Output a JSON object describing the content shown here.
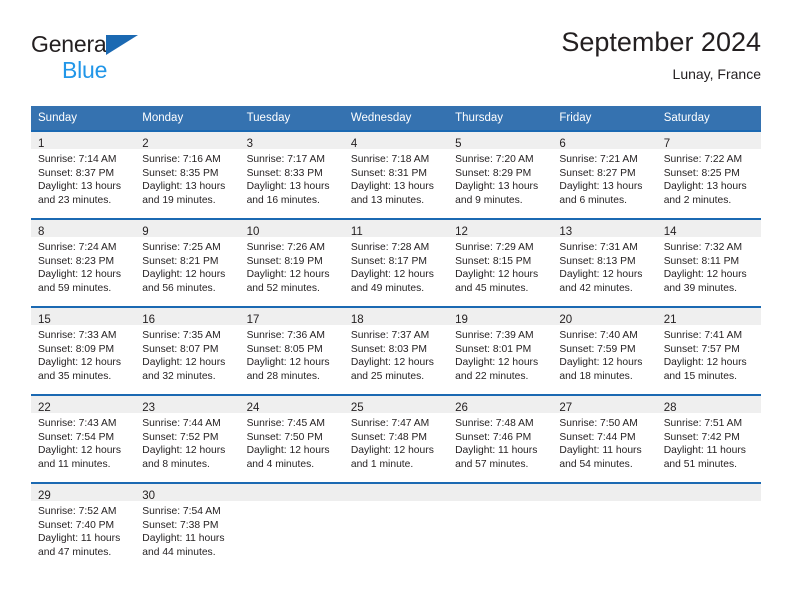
{
  "brand": {
    "name_dark": "General",
    "name_light": "Blue",
    "logo_icon": "triangle-icon"
  },
  "header": {
    "month_title": "September 2024",
    "location": "Lunay, France"
  },
  "theme": {
    "header_blue": "#3572b0",
    "rule_blue": "#1b69b2",
    "daynum_band": "#efefef",
    "brand_blue": "#2196e8",
    "text": "#231f20"
  },
  "weekday_headers": [
    "Sunday",
    "Monday",
    "Tuesday",
    "Wednesday",
    "Thursday",
    "Friday",
    "Saturday"
  ],
  "labels": {
    "sunrise": "Sunrise:",
    "sunset": "Sunset:",
    "daylight": "Daylight:"
  },
  "weeks": [
    [
      {
        "day": "1",
        "sunrise": "Sunrise: 7:14 AM",
        "sunset": "Sunset: 8:37 PM",
        "daylight_1": "Daylight: 13 hours",
        "daylight_2": "and 23 minutes."
      },
      {
        "day": "2",
        "sunrise": "Sunrise: 7:16 AM",
        "sunset": "Sunset: 8:35 PM",
        "daylight_1": "Daylight: 13 hours",
        "daylight_2": "and 19 minutes."
      },
      {
        "day": "3",
        "sunrise": "Sunrise: 7:17 AM",
        "sunset": "Sunset: 8:33 PM",
        "daylight_1": "Daylight: 13 hours",
        "daylight_2": "and 16 minutes."
      },
      {
        "day": "4",
        "sunrise": "Sunrise: 7:18 AM",
        "sunset": "Sunset: 8:31 PM",
        "daylight_1": "Daylight: 13 hours",
        "daylight_2": "and 13 minutes."
      },
      {
        "day": "5",
        "sunrise": "Sunrise: 7:20 AM",
        "sunset": "Sunset: 8:29 PM",
        "daylight_1": "Daylight: 13 hours",
        "daylight_2": "and 9 minutes."
      },
      {
        "day": "6",
        "sunrise": "Sunrise: 7:21 AM",
        "sunset": "Sunset: 8:27 PM",
        "daylight_1": "Daylight: 13 hours",
        "daylight_2": "and 6 minutes."
      },
      {
        "day": "7",
        "sunrise": "Sunrise: 7:22 AM",
        "sunset": "Sunset: 8:25 PM",
        "daylight_1": "Daylight: 13 hours",
        "daylight_2": "and 2 minutes."
      }
    ],
    [
      {
        "day": "8",
        "sunrise": "Sunrise: 7:24 AM",
        "sunset": "Sunset: 8:23 PM",
        "daylight_1": "Daylight: 12 hours",
        "daylight_2": "and 59 minutes."
      },
      {
        "day": "9",
        "sunrise": "Sunrise: 7:25 AM",
        "sunset": "Sunset: 8:21 PM",
        "daylight_1": "Daylight: 12 hours",
        "daylight_2": "and 56 minutes."
      },
      {
        "day": "10",
        "sunrise": "Sunrise: 7:26 AM",
        "sunset": "Sunset: 8:19 PM",
        "daylight_1": "Daylight: 12 hours",
        "daylight_2": "and 52 minutes."
      },
      {
        "day": "11",
        "sunrise": "Sunrise: 7:28 AM",
        "sunset": "Sunset: 8:17 PM",
        "daylight_1": "Daylight: 12 hours",
        "daylight_2": "and 49 minutes."
      },
      {
        "day": "12",
        "sunrise": "Sunrise: 7:29 AM",
        "sunset": "Sunset: 8:15 PM",
        "daylight_1": "Daylight: 12 hours",
        "daylight_2": "and 45 minutes."
      },
      {
        "day": "13",
        "sunrise": "Sunrise: 7:31 AM",
        "sunset": "Sunset: 8:13 PM",
        "daylight_1": "Daylight: 12 hours",
        "daylight_2": "and 42 minutes."
      },
      {
        "day": "14",
        "sunrise": "Sunrise: 7:32 AM",
        "sunset": "Sunset: 8:11 PM",
        "daylight_1": "Daylight: 12 hours",
        "daylight_2": "and 39 minutes."
      }
    ],
    [
      {
        "day": "15",
        "sunrise": "Sunrise: 7:33 AM",
        "sunset": "Sunset: 8:09 PM",
        "daylight_1": "Daylight: 12 hours",
        "daylight_2": "and 35 minutes."
      },
      {
        "day": "16",
        "sunrise": "Sunrise: 7:35 AM",
        "sunset": "Sunset: 8:07 PM",
        "daylight_1": "Daylight: 12 hours",
        "daylight_2": "and 32 minutes."
      },
      {
        "day": "17",
        "sunrise": "Sunrise: 7:36 AM",
        "sunset": "Sunset: 8:05 PM",
        "daylight_1": "Daylight: 12 hours",
        "daylight_2": "and 28 minutes."
      },
      {
        "day": "18",
        "sunrise": "Sunrise: 7:37 AM",
        "sunset": "Sunset: 8:03 PM",
        "daylight_1": "Daylight: 12 hours",
        "daylight_2": "and 25 minutes."
      },
      {
        "day": "19",
        "sunrise": "Sunrise: 7:39 AM",
        "sunset": "Sunset: 8:01 PM",
        "daylight_1": "Daylight: 12 hours",
        "daylight_2": "and 22 minutes."
      },
      {
        "day": "20",
        "sunrise": "Sunrise: 7:40 AM",
        "sunset": "Sunset: 7:59 PM",
        "daylight_1": "Daylight: 12 hours",
        "daylight_2": "and 18 minutes."
      },
      {
        "day": "21",
        "sunrise": "Sunrise: 7:41 AM",
        "sunset": "Sunset: 7:57 PM",
        "daylight_1": "Daylight: 12 hours",
        "daylight_2": "and 15 minutes."
      }
    ],
    [
      {
        "day": "22",
        "sunrise": "Sunrise: 7:43 AM",
        "sunset": "Sunset: 7:54 PM",
        "daylight_1": "Daylight: 12 hours",
        "daylight_2": "and 11 minutes."
      },
      {
        "day": "23",
        "sunrise": "Sunrise: 7:44 AM",
        "sunset": "Sunset: 7:52 PM",
        "daylight_1": "Daylight: 12 hours",
        "daylight_2": "and 8 minutes."
      },
      {
        "day": "24",
        "sunrise": "Sunrise: 7:45 AM",
        "sunset": "Sunset: 7:50 PM",
        "daylight_1": "Daylight: 12 hours",
        "daylight_2": "and 4 minutes."
      },
      {
        "day": "25",
        "sunrise": "Sunrise: 7:47 AM",
        "sunset": "Sunset: 7:48 PM",
        "daylight_1": "Daylight: 12 hours",
        "daylight_2": "and 1 minute."
      },
      {
        "day": "26",
        "sunrise": "Sunrise: 7:48 AM",
        "sunset": "Sunset: 7:46 PM",
        "daylight_1": "Daylight: 11 hours",
        "daylight_2": "and 57 minutes."
      },
      {
        "day": "27",
        "sunrise": "Sunrise: 7:50 AM",
        "sunset": "Sunset: 7:44 PM",
        "daylight_1": "Daylight: 11 hours",
        "daylight_2": "and 54 minutes."
      },
      {
        "day": "28",
        "sunrise": "Sunrise: 7:51 AM",
        "sunset": "Sunset: 7:42 PM",
        "daylight_1": "Daylight: 11 hours",
        "daylight_2": "and 51 minutes."
      }
    ],
    [
      {
        "day": "29",
        "sunrise": "Sunrise: 7:52 AM",
        "sunset": "Sunset: 7:40 PM",
        "daylight_1": "Daylight: 11 hours",
        "daylight_2": "and 47 minutes."
      },
      {
        "day": "30",
        "sunrise": "Sunrise: 7:54 AM",
        "sunset": "Sunset: 7:38 PM",
        "daylight_1": "Daylight: 11 hours",
        "daylight_2": "and 44 minutes."
      },
      {
        "day": "",
        "sunrise": "",
        "sunset": "",
        "daylight_1": "",
        "daylight_2": ""
      },
      {
        "day": "",
        "sunrise": "",
        "sunset": "",
        "daylight_1": "",
        "daylight_2": ""
      },
      {
        "day": "",
        "sunrise": "",
        "sunset": "",
        "daylight_1": "",
        "daylight_2": ""
      },
      {
        "day": "",
        "sunrise": "",
        "sunset": "",
        "daylight_1": "",
        "daylight_2": ""
      },
      {
        "day": "",
        "sunrise": "",
        "sunset": "",
        "daylight_1": "",
        "daylight_2": ""
      }
    ]
  ]
}
